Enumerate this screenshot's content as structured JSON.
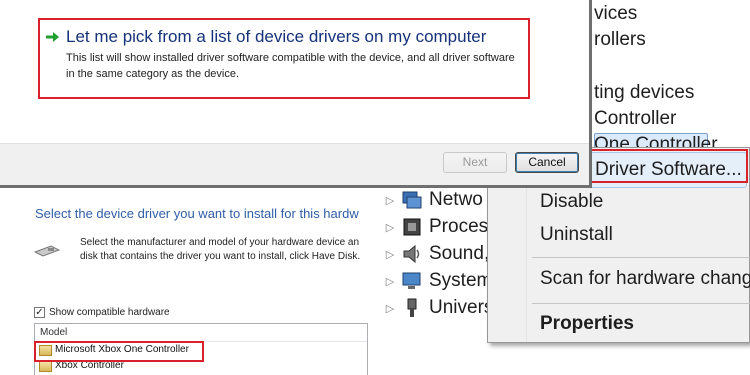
{
  "device_manager": {
    "top_items": [
      "vices",
      "rollers",
      "ting devices",
      "Controller",
      "One Controller"
    ],
    "tree": [
      {
        "label": "Netwo",
        "icon": "network-adapter-icon"
      },
      {
        "label": "Proces",
        "icon": "processor-icon"
      },
      {
        "label": "Sound,",
        "icon": "speaker-icon"
      },
      {
        "label": "System",
        "icon": "computer-icon"
      },
      {
        "label": "Univers",
        "icon": "usb-icon"
      }
    ]
  },
  "context_menu": {
    "update": "Driver Software...",
    "disable": "Disable",
    "uninstall": "Uninstall",
    "scan": "Scan for hardware changes",
    "properties": "Properties"
  },
  "wizard": {
    "heading": "Select the device driver you want to install for this hardw",
    "desc_line1": "Select the manufacturer and model of your hardware device an",
    "desc_line2": "disk that contains the driver you want to install, click Have Disk.",
    "show_compatible": "Show compatible hardware",
    "model_header": "Model",
    "models": [
      "Microsoft Xbox One Controller",
      "Xbox Controller"
    ]
  },
  "dialog": {
    "option_title": "Let me pick from a list of device drivers on my computer",
    "option_desc": "This list will show installed driver software compatible with the device, and all driver software in the same category as the device.",
    "next": "Next",
    "cancel": "Cancel"
  },
  "colors": {
    "highlight_border": "#d9212c",
    "link_blue": "#15327a"
  }
}
